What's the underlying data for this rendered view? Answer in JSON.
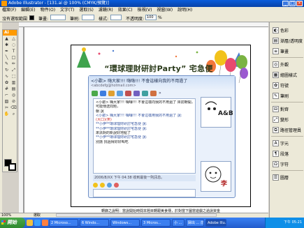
{
  "window": {
    "title": "Adobe Illustrator - [131.ai @ 100% (CMYK/預覽)]"
  },
  "menubar": [
    "檔案(F)",
    "編輯(E)",
    "物件(O)",
    "文字(T)",
    "選取(S)",
    "濾鏡(R)",
    "效果(C)",
    "檢視(V)",
    "視窗(W)",
    "說明(H)"
  ],
  "optionsbar": {
    "label": "沒有選取範圍",
    "stroke_label": "筆畫:",
    "brush_label": "筆刷:",
    "style_label": "樣式:",
    "opacity_label": "不透明度:",
    "opacity_value": "100",
    "opacity_unit": "%"
  },
  "toolbox": {
    "title": "Ai"
  },
  "artwork": {
    "banner_title": "“環球理財研討Party” 宅急便",
    "caption": "轉錄之說明：當說開始時間本題目轉跟美食傳，於對當下圖當遊戲之過說資金"
  },
  "messenger": {
    "contact_name": "<小歡> 嗨大家!!! 嗨嗨!!! 不會這樣向我的不用過了",
    "contact_email": "<abcdefg@hotmail.com>",
    "more_label": "»",
    "conversation": [
      "<小歡> 嗨大家!!! 嗨嗨!!! 不會這樣向我的不用過了 目前轉開，",
      "可能傳送問題，",
      "      朝  說",
      "<小歡> 嗨大家!!! 嗨嗨!!! 不會這樣用我的不用過了 說:",
      "      (大口)(笑)",
      "**小伊**環球理財研討宅急便 說:",
      "",
      "**小伊**環球理財研討宅急便 說:",
      "      來派對的新說好地點了",
      "**小伊**環球理財研討宅急便 說:",
      "",
      "      別擔    找過得好好喝吃"
    ],
    "footer": "2006/8/XX 下午 04:38 收到最後一則訊息。",
    "avatar_top_caption": "A&B",
    "avatar_bottom_caption": "李"
  },
  "right_panels": [
    "色彩",
    "漸層/透明度",
    "筆畫",
    "外觀",
    "繪圖樣式",
    "符號",
    "筆刷",
    "對齊",
    "變形",
    "路徑管理員",
    "字元",
    "段落",
    "字符",
    "圖層"
  ],
  "status": {
    "zoom": "100%",
    "mode": "選取"
  },
  "taskbar": {
    "start": "開始",
    "tasks": [
      "2 Microso...",
      "6 Windo...",
      "Windows...",
      "3 Micros...",
      "小 ...",
      "歸出 ... 前",
      "Adobe Illu...",
      "無標題-小..."
    ],
    "clock": "下午 05:21"
  },
  "colors": {
    "banner_balloons": [
      "#f2c21b",
      "#e84a6f",
      "#7ab342",
      "#4a7bd0",
      "#f2773b",
      "#9b59d0"
    ],
    "msn_accent": "#6f8fc6",
    "taskbar": "#225bcc",
    "start_button": "#2f8a2f"
  }
}
